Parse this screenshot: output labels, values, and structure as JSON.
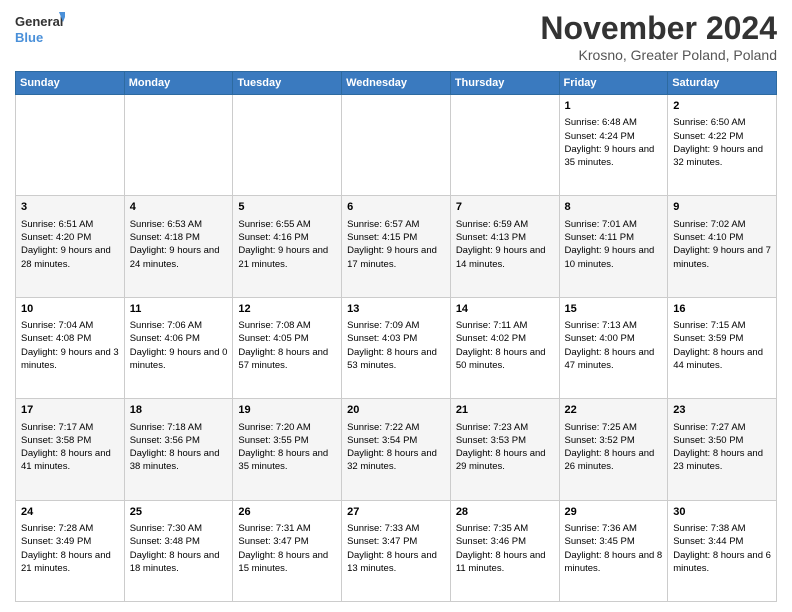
{
  "header": {
    "logo_line1": "General",
    "logo_line2": "Blue",
    "title": "November 2024",
    "subtitle": "Krosno, Greater Poland, Poland"
  },
  "weekdays": [
    "Sunday",
    "Monday",
    "Tuesday",
    "Wednesday",
    "Thursday",
    "Friday",
    "Saturday"
  ],
  "weeks": [
    [
      {
        "day": "",
        "info": ""
      },
      {
        "day": "",
        "info": ""
      },
      {
        "day": "",
        "info": ""
      },
      {
        "day": "",
        "info": ""
      },
      {
        "day": "",
        "info": ""
      },
      {
        "day": "1",
        "info": "Sunrise: 6:48 AM\nSunset: 4:24 PM\nDaylight: 9 hours and 35 minutes."
      },
      {
        "day": "2",
        "info": "Sunrise: 6:50 AM\nSunset: 4:22 PM\nDaylight: 9 hours and 32 minutes."
      }
    ],
    [
      {
        "day": "3",
        "info": "Sunrise: 6:51 AM\nSunset: 4:20 PM\nDaylight: 9 hours and 28 minutes."
      },
      {
        "day": "4",
        "info": "Sunrise: 6:53 AM\nSunset: 4:18 PM\nDaylight: 9 hours and 24 minutes."
      },
      {
        "day": "5",
        "info": "Sunrise: 6:55 AM\nSunset: 4:16 PM\nDaylight: 9 hours and 21 minutes."
      },
      {
        "day": "6",
        "info": "Sunrise: 6:57 AM\nSunset: 4:15 PM\nDaylight: 9 hours and 17 minutes."
      },
      {
        "day": "7",
        "info": "Sunrise: 6:59 AM\nSunset: 4:13 PM\nDaylight: 9 hours and 14 minutes."
      },
      {
        "day": "8",
        "info": "Sunrise: 7:01 AM\nSunset: 4:11 PM\nDaylight: 9 hours and 10 minutes."
      },
      {
        "day": "9",
        "info": "Sunrise: 7:02 AM\nSunset: 4:10 PM\nDaylight: 9 hours and 7 minutes."
      }
    ],
    [
      {
        "day": "10",
        "info": "Sunrise: 7:04 AM\nSunset: 4:08 PM\nDaylight: 9 hours and 3 minutes."
      },
      {
        "day": "11",
        "info": "Sunrise: 7:06 AM\nSunset: 4:06 PM\nDaylight: 9 hours and 0 minutes."
      },
      {
        "day": "12",
        "info": "Sunrise: 7:08 AM\nSunset: 4:05 PM\nDaylight: 8 hours and 57 minutes."
      },
      {
        "day": "13",
        "info": "Sunrise: 7:09 AM\nSunset: 4:03 PM\nDaylight: 8 hours and 53 minutes."
      },
      {
        "day": "14",
        "info": "Sunrise: 7:11 AM\nSunset: 4:02 PM\nDaylight: 8 hours and 50 minutes."
      },
      {
        "day": "15",
        "info": "Sunrise: 7:13 AM\nSunset: 4:00 PM\nDaylight: 8 hours and 47 minutes."
      },
      {
        "day": "16",
        "info": "Sunrise: 7:15 AM\nSunset: 3:59 PM\nDaylight: 8 hours and 44 minutes."
      }
    ],
    [
      {
        "day": "17",
        "info": "Sunrise: 7:17 AM\nSunset: 3:58 PM\nDaylight: 8 hours and 41 minutes."
      },
      {
        "day": "18",
        "info": "Sunrise: 7:18 AM\nSunset: 3:56 PM\nDaylight: 8 hours and 38 minutes."
      },
      {
        "day": "19",
        "info": "Sunrise: 7:20 AM\nSunset: 3:55 PM\nDaylight: 8 hours and 35 minutes."
      },
      {
        "day": "20",
        "info": "Sunrise: 7:22 AM\nSunset: 3:54 PM\nDaylight: 8 hours and 32 minutes."
      },
      {
        "day": "21",
        "info": "Sunrise: 7:23 AM\nSunset: 3:53 PM\nDaylight: 8 hours and 29 minutes."
      },
      {
        "day": "22",
        "info": "Sunrise: 7:25 AM\nSunset: 3:52 PM\nDaylight: 8 hours and 26 minutes."
      },
      {
        "day": "23",
        "info": "Sunrise: 7:27 AM\nSunset: 3:50 PM\nDaylight: 8 hours and 23 minutes."
      }
    ],
    [
      {
        "day": "24",
        "info": "Sunrise: 7:28 AM\nSunset: 3:49 PM\nDaylight: 8 hours and 21 minutes."
      },
      {
        "day": "25",
        "info": "Sunrise: 7:30 AM\nSunset: 3:48 PM\nDaylight: 8 hours and 18 minutes."
      },
      {
        "day": "26",
        "info": "Sunrise: 7:31 AM\nSunset: 3:47 PM\nDaylight: 8 hours and 15 minutes."
      },
      {
        "day": "27",
        "info": "Sunrise: 7:33 AM\nSunset: 3:47 PM\nDaylight: 8 hours and 13 minutes."
      },
      {
        "day": "28",
        "info": "Sunrise: 7:35 AM\nSunset: 3:46 PM\nDaylight: 8 hours and 11 minutes."
      },
      {
        "day": "29",
        "info": "Sunrise: 7:36 AM\nSunset: 3:45 PM\nDaylight: 8 hours and 8 minutes."
      },
      {
        "day": "30",
        "info": "Sunrise: 7:38 AM\nSunset: 3:44 PM\nDaylight: 8 hours and 6 minutes."
      }
    ]
  ]
}
